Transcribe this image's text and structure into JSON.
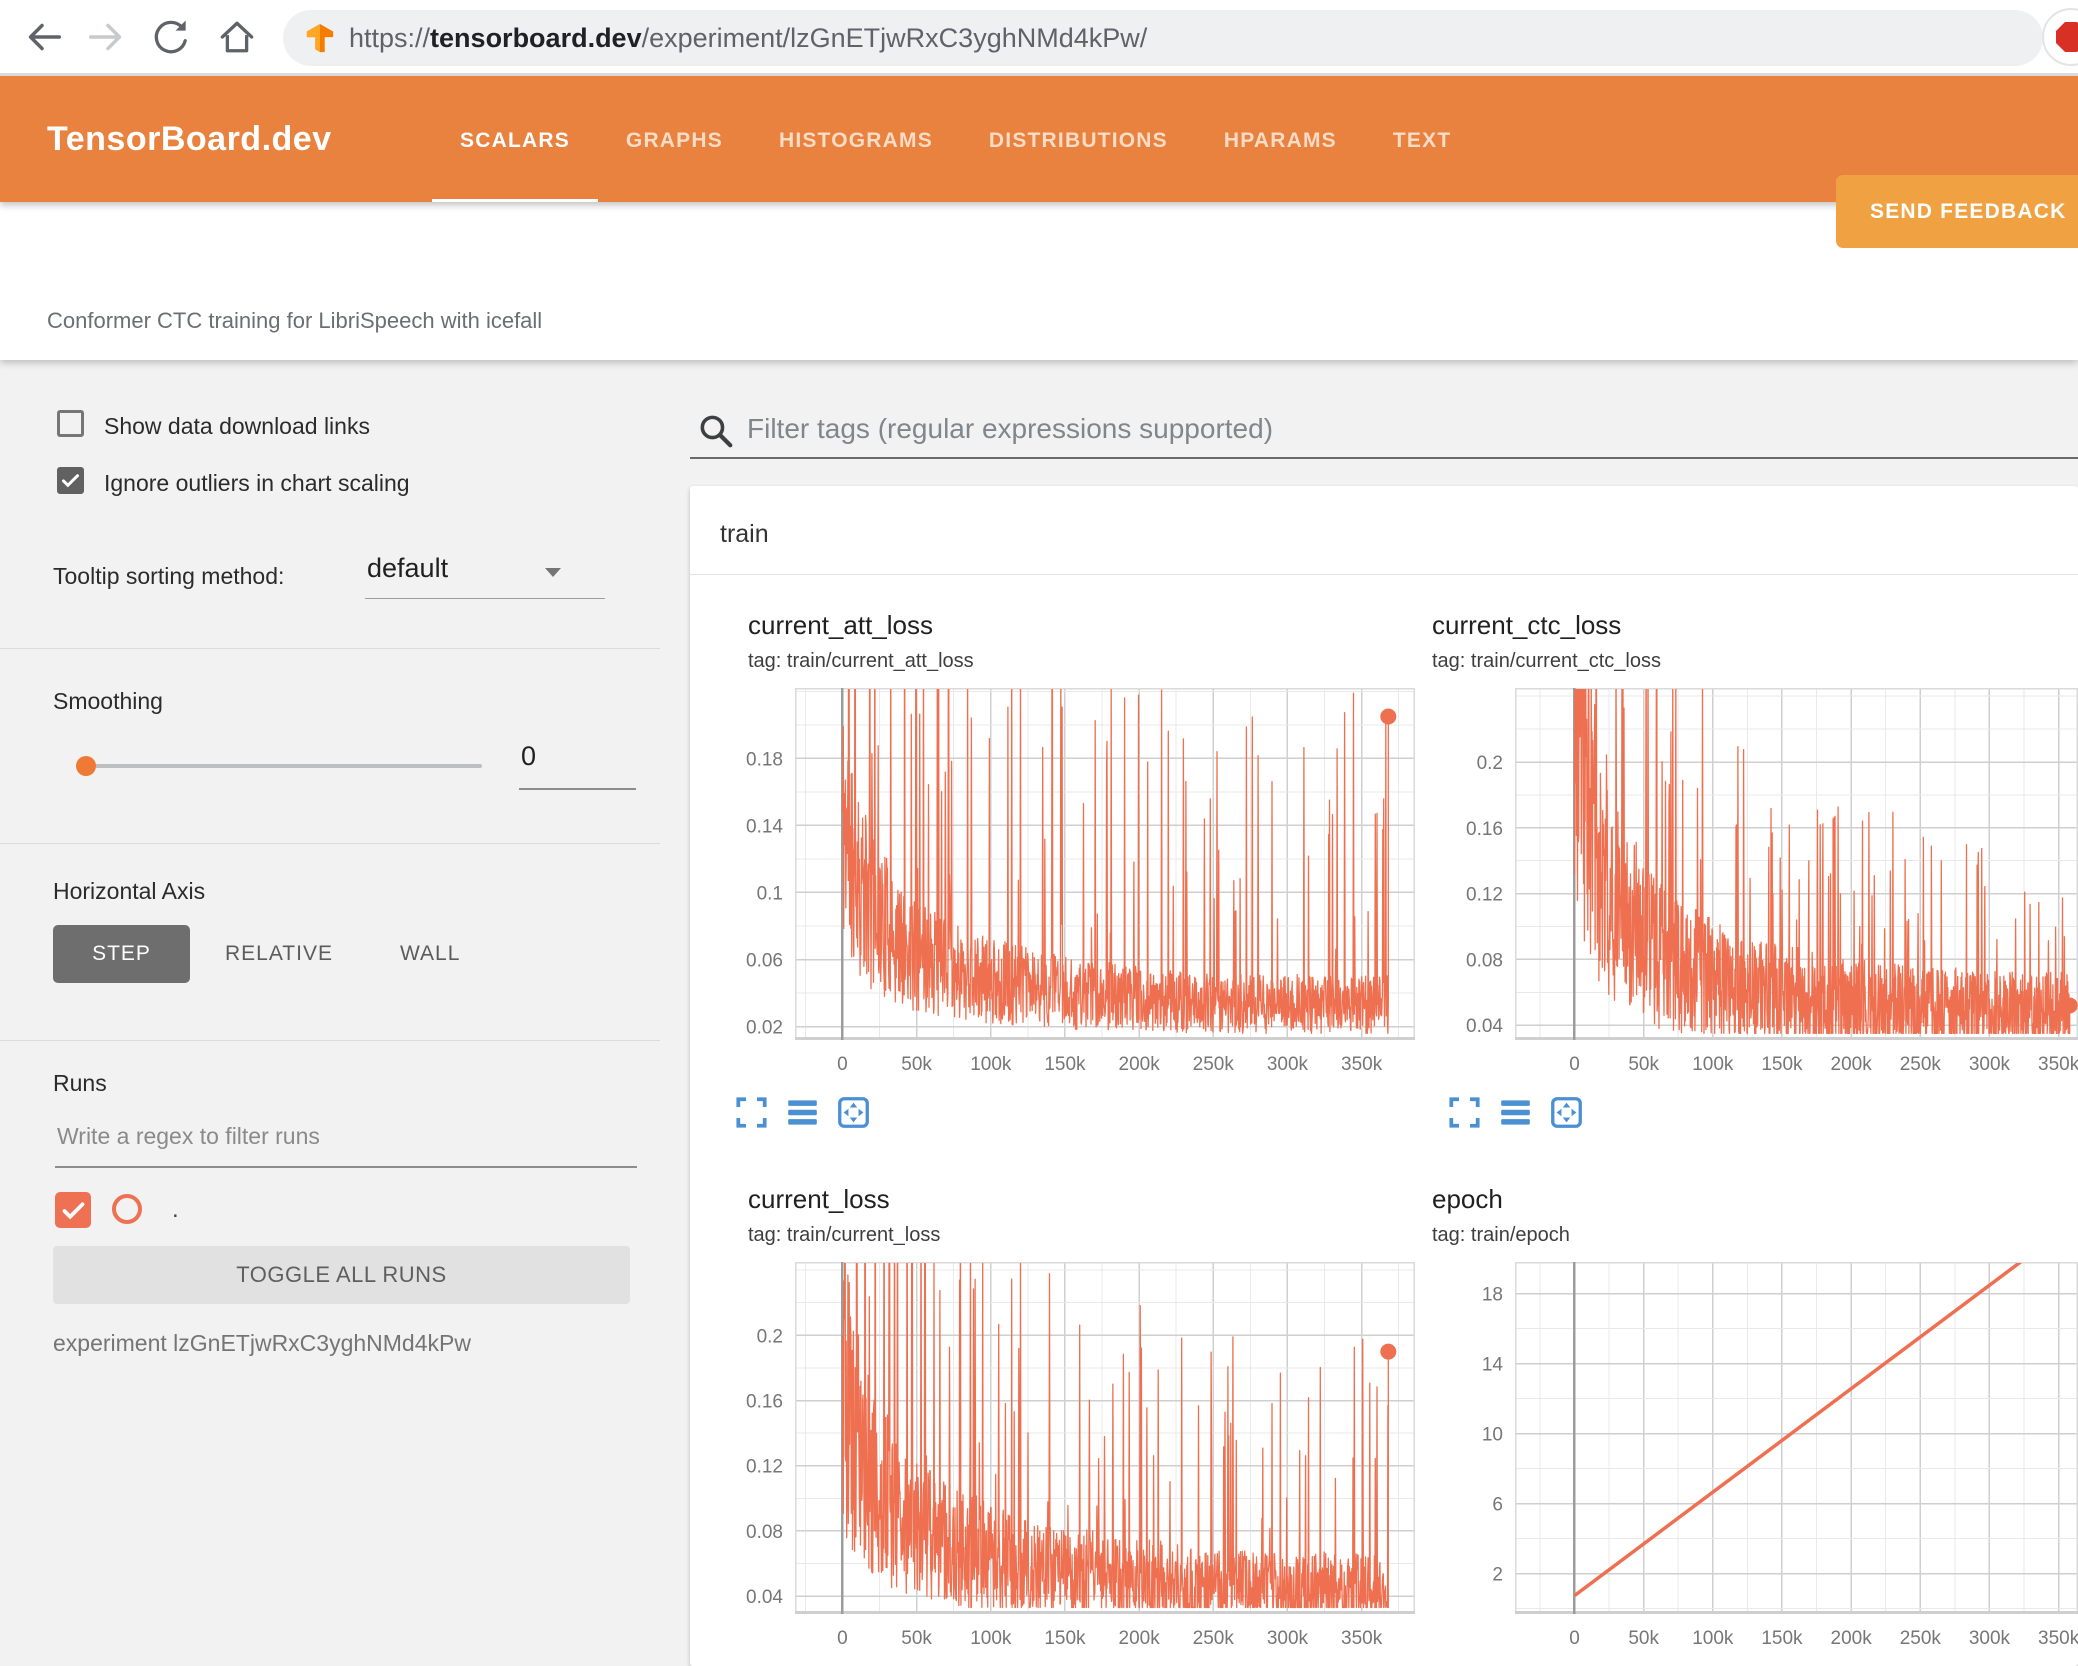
{
  "browser": {
    "url_scheme": "https://",
    "url_domain": "tensorboard.dev",
    "url_path": "/experiment/lzGnETjwRxC3yghNMd4kPw/"
  },
  "header": {
    "logo": "TensorBoard.dev",
    "tabs": [
      {
        "label": "SCALARS",
        "active": true
      },
      {
        "label": "GRAPHS",
        "active": false
      },
      {
        "label": "HISTOGRAMS",
        "active": false
      },
      {
        "label": "DISTRIBUTIONS",
        "active": false
      },
      {
        "label": "HPARAMS",
        "active": false
      },
      {
        "label": "TEXT",
        "active": false
      }
    ],
    "feedback_button": "SEND FEEDBACK"
  },
  "subtitle": "Conformer CTC training for LibriSpeech with icefall",
  "sidebar": {
    "show_download": {
      "label": "Show data download links",
      "checked": false
    },
    "ignore_outliers": {
      "label": "Ignore outliers in chart scaling",
      "checked": true
    },
    "tooltip_sorting": {
      "label": "Tooltip sorting method:",
      "value": "default"
    },
    "smoothing": {
      "label": "Smoothing",
      "value": "0"
    },
    "horizontal_axis": {
      "label": "Horizontal Axis",
      "options": [
        "STEP",
        "RELATIVE",
        "WALL"
      ],
      "selected": "STEP"
    },
    "runs": {
      "label": "Runs",
      "filter_placeholder": "Write a regex to filter runs",
      "run_item": ".",
      "run_checked": true,
      "toggle_all": "TOGGLE ALL RUNS",
      "experiment": "experiment lzGnETjwRxC3yghNMd4kPw"
    }
  },
  "main": {
    "filter_placeholder": "Filter tags (regular expressions supported)",
    "section": "train"
  },
  "colors": {
    "appbar": "#e8823e",
    "feedback_button": "#f0a243",
    "series_orange": "#ee7050",
    "toolbar_icon_blue": "#4a90d2",
    "grid_major": "#cfcfcf",
    "grid_minor": "#e9e9e9",
    "axis_zero_line": "#9c9c9c",
    "tick_label": "#767676"
  },
  "chart_data": [
    {
      "type": "line",
      "style": "noisy",
      "title": "current_att_loss",
      "tag": "tag: train/current_att_loss",
      "color": "#ee7050",
      "xlim": [
        -32000,
        386000
      ],
      "ylim": [
        0.012,
        0.222
      ],
      "x_ticks": {
        "values": [
          0,
          50000,
          100000,
          150000,
          200000,
          250000,
          300000,
          350000
        ],
        "labels": [
          "0",
          "50k",
          "100k",
          "150k",
          "200k",
          "250k",
          "300k",
          "350k"
        ],
        "minor_step": 25000
      },
      "y_ticks": {
        "values": [
          0.02,
          0.06,
          0.1,
          0.14,
          0.18
        ],
        "labels": [
          "0.02",
          "0.06",
          "0.1",
          "0.14",
          "0.18"
        ],
        "minor_step": 0.02
      },
      "series": {
        "data_xmax": 368000,
        "seed": 11,
        "n_points": 1300,
        "spike_prob": 0.07,
        "base_envelope": [
          [
            0,
            0.15
          ],
          [
            15000,
            0.1
          ],
          [
            40000,
            0.068
          ],
          [
            90000,
            0.05
          ],
          [
            160000,
            0.04
          ],
          [
            260000,
            0.034
          ],
          [
            368000,
            0.034
          ]
        ],
        "spike_envelope": [
          [
            0,
            0.5
          ],
          [
            40000,
            0.3
          ],
          [
            100000,
            0.22
          ],
          [
            200000,
            0.19
          ],
          [
            368000,
            0.19
          ]
        ]
      },
      "end_dot": [
        368000,
        0.205
      ]
    },
    {
      "type": "line",
      "style": "noisy",
      "title": "current_ctc_loss",
      "tag": "tag: train/current_ctc_loss",
      "color": "#ee7050",
      "xlim": [
        -43000,
        364000
      ],
      "ylim": [
        0.031,
        0.245
      ],
      "x_ticks": {
        "values": [
          0,
          50000,
          100000,
          150000,
          200000,
          250000,
          300000,
          350000
        ],
        "labels": [
          "0",
          "50k",
          "100k",
          "150k",
          "200k",
          "250k",
          "300k",
          "350k"
        ],
        "minor_step": 25000
      },
      "y_ticks": {
        "values": [
          0.04,
          0.08,
          0.12,
          0.16,
          0.2
        ],
        "labels": [
          "0.04",
          "0.08",
          "0.12",
          "0.16",
          "0.2"
        ],
        "minor_step": 0.02
      },
      "series": {
        "data_xmax": 358000,
        "seed": 23,
        "n_points": 1300,
        "spike_prob": 0.06,
        "base_envelope": [
          [
            0,
            0.24
          ],
          [
            20000,
            0.13
          ],
          [
            60000,
            0.085
          ],
          [
            120000,
            0.062
          ],
          [
            250000,
            0.05
          ],
          [
            358000,
            0.048
          ]
        ],
        "spike_envelope": [
          [
            0,
            0.4
          ],
          [
            60000,
            0.22
          ],
          [
            150000,
            0.13
          ],
          [
            358000,
            0.1
          ]
        ]
      },
      "end_dot": [
        358000,
        0.052
      ]
    },
    {
      "type": "line",
      "style": "noisy",
      "title": "current_loss",
      "tag": "tag: train/current_loss",
      "color": "#ee7050",
      "xlim": [
        -32000,
        386000
      ],
      "ylim": [
        0.029,
        0.245
      ],
      "x_ticks": {
        "values": [
          0,
          50000,
          100000,
          150000,
          200000,
          250000,
          300000,
          350000
        ],
        "labels": [
          "0",
          "50k",
          "100k",
          "150k",
          "200k",
          "250k",
          "300k",
          "350k"
        ],
        "minor_step": 25000
      },
      "y_ticks": {
        "values": [
          0.04,
          0.08,
          0.12,
          0.16,
          0.2
        ],
        "labels": [
          "0.04",
          "0.08",
          "0.12",
          "0.16",
          "0.2"
        ],
        "minor_step": 0.02
      },
      "series": {
        "data_xmax": 368000,
        "seed": 5,
        "n_points": 1300,
        "spike_prob": 0.065,
        "base_envelope": [
          [
            0,
            0.17
          ],
          [
            20000,
            0.11
          ],
          [
            60000,
            0.078
          ],
          [
            120000,
            0.058
          ],
          [
            250000,
            0.046
          ],
          [
            368000,
            0.044
          ]
        ],
        "spike_envelope": [
          [
            0,
            0.45
          ],
          [
            60000,
            0.27
          ],
          [
            150000,
            0.18
          ],
          [
            368000,
            0.16
          ]
        ]
      },
      "end_dot": [
        368000,
        0.19
      ]
    },
    {
      "type": "line",
      "style": "straight",
      "title": "epoch",
      "tag": "tag: train/epoch",
      "color": "#ee7050",
      "xlim": [
        -43000,
        364000
      ],
      "ylim": [
        -0.3,
        19.8
      ],
      "x_ticks": {
        "values": [
          0,
          50000,
          100000,
          150000,
          200000,
          250000,
          300000,
          350000
        ],
        "labels": [
          "0",
          "50k",
          "100k",
          "150k",
          "200k",
          "250k",
          "300k",
          "350k"
        ],
        "minor_step": 25000
      },
      "y_ticks": {
        "values": [
          2,
          6,
          10,
          14,
          18
        ],
        "labels": [
          "2",
          "6",
          "10",
          "14",
          "18"
        ],
        "minor_step": 2
      },
      "series": {
        "points": [
          [
            0,
            0.75
          ],
          [
            380000,
            23.2
          ]
        ]
      }
    }
  ]
}
